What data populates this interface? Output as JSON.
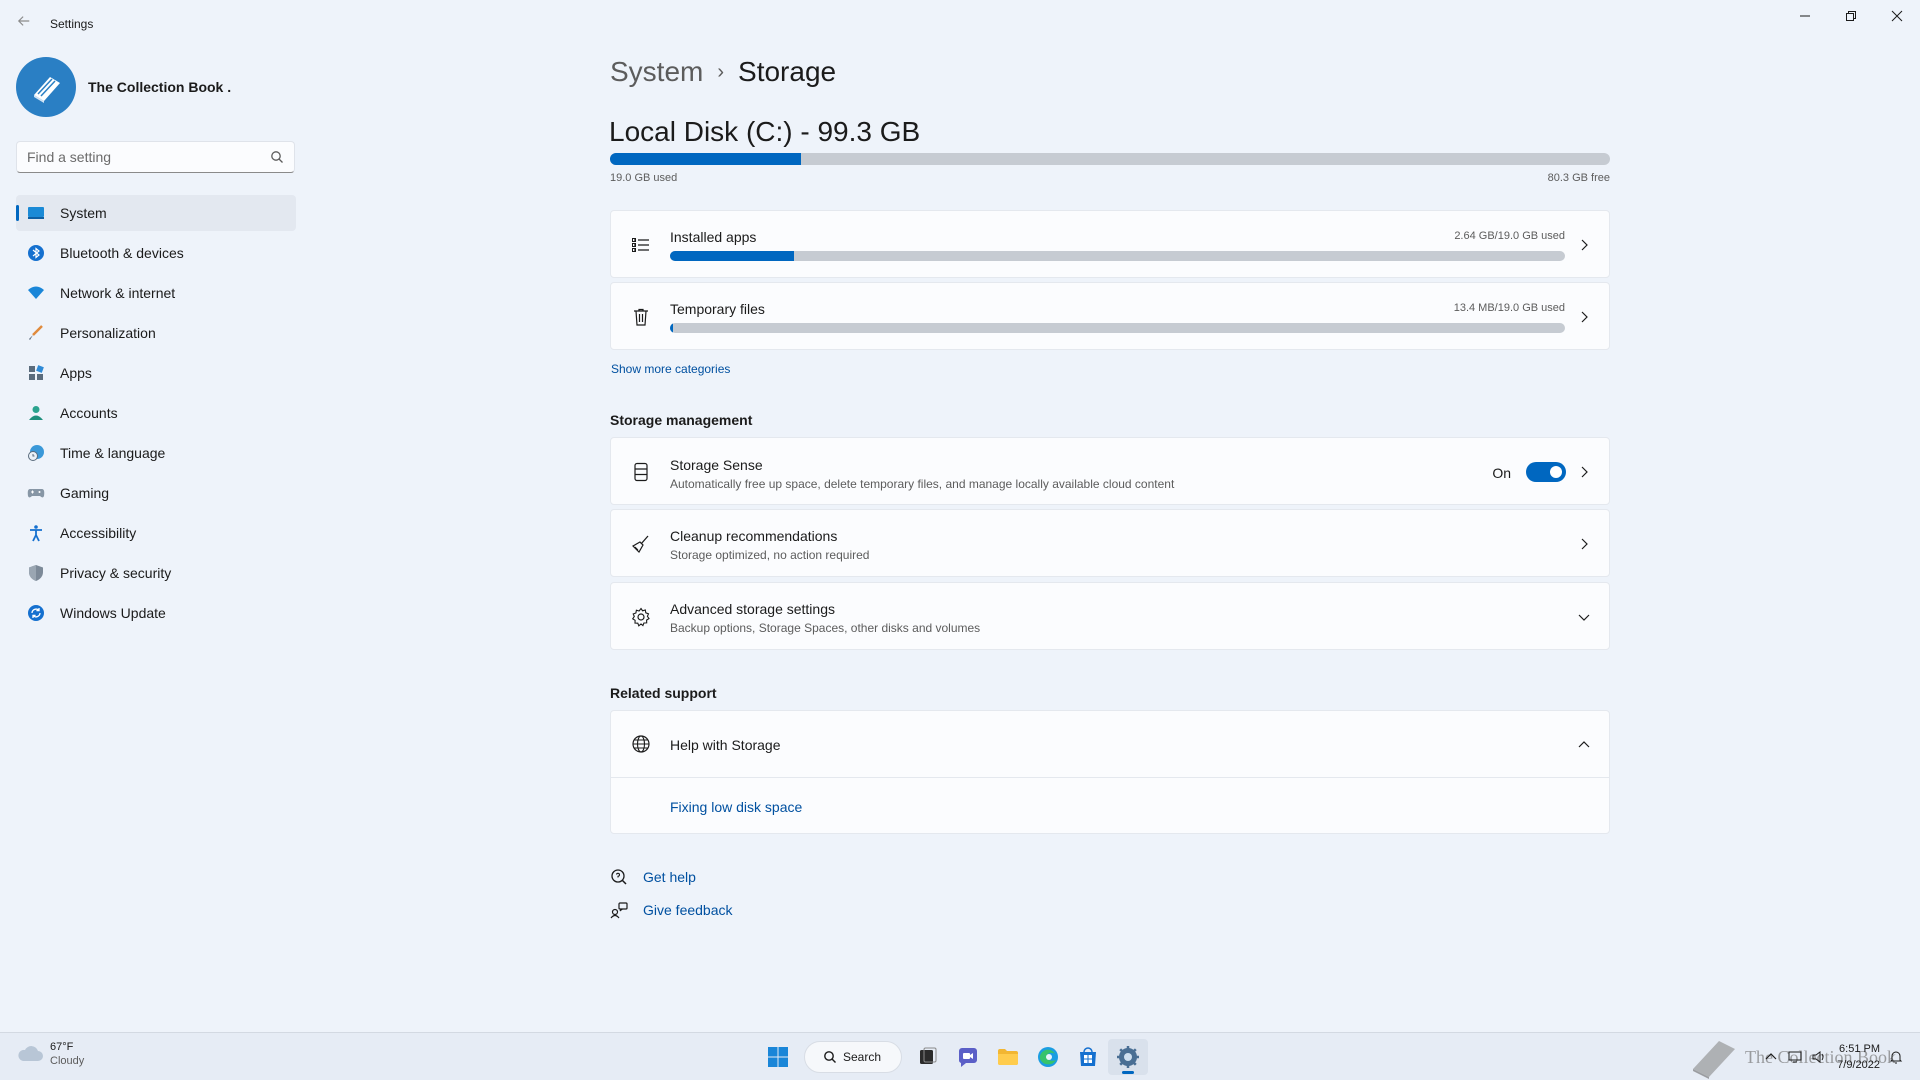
{
  "window": {
    "title": "Settings"
  },
  "profile": {
    "name": "The Collection Book ."
  },
  "search": {
    "placeholder": "Find a setting"
  },
  "nav": [
    {
      "label": "System",
      "icon": "system-icon",
      "active": true
    },
    {
      "label": "Bluetooth & devices",
      "icon": "bluetooth-icon"
    },
    {
      "label": "Network & internet",
      "icon": "wifi-icon"
    },
    {
      "label": "Personalization",
      "icon": "brush-icon"
    },
    {
      "label": "Apps",
      "icon": "apps-icon"
    },
    {
      "label": "Accounts",
      "icon": "person-icon"
    },
    {
      "label": "Time & language",
      "icon": "clock-globe-icon"
    },
    {
      "label": "Gaming",
      "icon": "gamepad-icon"
    },
    {
      "label": "Accessibility",
      "icon": "accessibility-icon"
    },
    {
      "label": "Privacy & security",
      "icon": "shield-icon"
    },
    {
      "label": "Windows Update",
      "icon": "update-icon"
    }
  ],
  "breadcrumb": {
    "parent": "System",
    "separator": "›",
    "current": "Storage"
  },
  "disk": {
    "title": "Local Disk (C:) - 99.3 GB",
    "used_label": "19.0 GB used",
    "free_label": "80.3 GB free",
    "used_fraction": 0.191
  },
  "categories": [
    {
      "title": "Installed apps",
      "usage": "2.64 GB/19.0 GB used",
      "fraction": 0.139,
      "icon": "list-icon"
    },
    {
      "title": "Temporary files",
      "usage": "13.4 MB/19.0 GB used",
      "fraction": 0.002,
      "icon": "trash-icon"
    }
  ],
  "show_more": "Show more categories",
  "storage_management": {
    "heading": "Storage management",
    "storage_sense": {
      "title": "Storage Sense",
      "desc": "Automatically free up space, delete temporary files, and manage locally available cloud content",
      "toggle_label": "On",
      "enabled": true
    },
    "cleanup": {
      "title": "Cleanup recommendations",
      "desc": "Storage optimized, no action required"
    },
    "advanced": {
      "title": "Advanced storage settings",
      "desc": "Backup options, Storage Spaces, other disks and volumes"
    }
  },
  "related_support": {
    "heading": "Related support",
    "help_title": "Help with Storage",
    "help_link": "Fixing low disk space"
  },
  "footer": {
    "get_help": "Get help",
    "give_feedback": "Give feedback"
  },
  "taskbar": {
    "weather_temp": "67°F",
    "weather_cond": "Cloudy",
    "search_label": "Search",
    "time": "6:51 PM",
    "date": "7/9/2022",
    "watermark": "The Collection Book"
  },
  "colors": {
    "accent": "#0067c0",
    "background": "#eef3fa",
    "card": "#fbfcfe"
  }
}
